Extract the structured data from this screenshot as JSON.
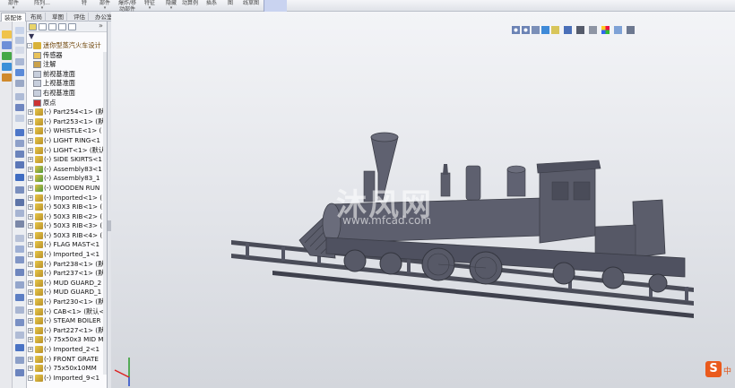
{
  "ribbon": {
    "items": [
      "部件",
      "阵列...",
      "特",
      "部件",
      "爆炸/移动部件",
      "特征",
      "隐藏",
      "动算例",
      "插系",
      "图",
      "线草图"
    ]
  },
  "tabs": [
    "装配体",
    "布局",
    "草图",
    "评估",
    "办公室产品"
  ],
  "tree": {
    "root": "迷你型蒸汽火车设计",
    "folders": [
      {
        "label": "传感器",
        "icon": "sensors-folder-icon"
      },
      {
        "label": "注解",
        "icon": "annotations-icon"
      },
      {
        "label": "前视基准面",
        "icon": "plane-icon"
      },
      {
        "label": "上视基准面",
        "icon": "plane-icon"
      },
      {
        "label": "右视基准面",
        "icon": "plane-icon"
      },
      {
        "label": "原点",
        "icon": "origin-icon"
      }
    ],
    "components": [
      "(-) Part254<1> (默",
      "(-) Part253<1> (默",
      "(-) WHISTLE<1> (",
      "(-) LIGHT RING<1",
      "(-) LIGHT<1> (默认",
      "(-) SIDE SKIRTS<1",
      "(-) Assembly83<1",
      "(-) Assembly83_1",
      "(-) WOODEN RUN",
      "(-) Imported<1> (",
      "(-) 50X3 RIB<1> (",
      "(-) 50X3 RIB<2> (",
      "(-) 50X3 RIB<3> (",
      "(-) 50X3 RIB<4> (",
      "(-) FLAG MAST<1",
      "(-) Imported_1<1",
      "(-) Part238<1> (默",
      "(-) Part237<1> (默",
      "(-) MUD GUARD_2",
      "(-) MUD GUARD_1",
      "(-) Part230<1> (默",
      "(-) CAB<1> (默认<",
      "(-) STEAM BOILER",
      "(-) Part227<1> (默",
      "(-) 75x50x3 MID M",
      "(-) Imported_2<1",
      "(-) FRONT GRATE",
      "(-) 75x50x10MM",
      "(-) Imported_9<1"
    ]
  },
  "watermark": {
    "text": "沐风网",
    "url": "www.mfcad.com"
  },
  "ime": {
    "logo": "S",
    "label": "中"
  },
  "colors": {
    "model": "#5a5c6a",
    "viewport_bg": "#e2e4e9",
    "accent": "#3a6fd8"
  }
}
